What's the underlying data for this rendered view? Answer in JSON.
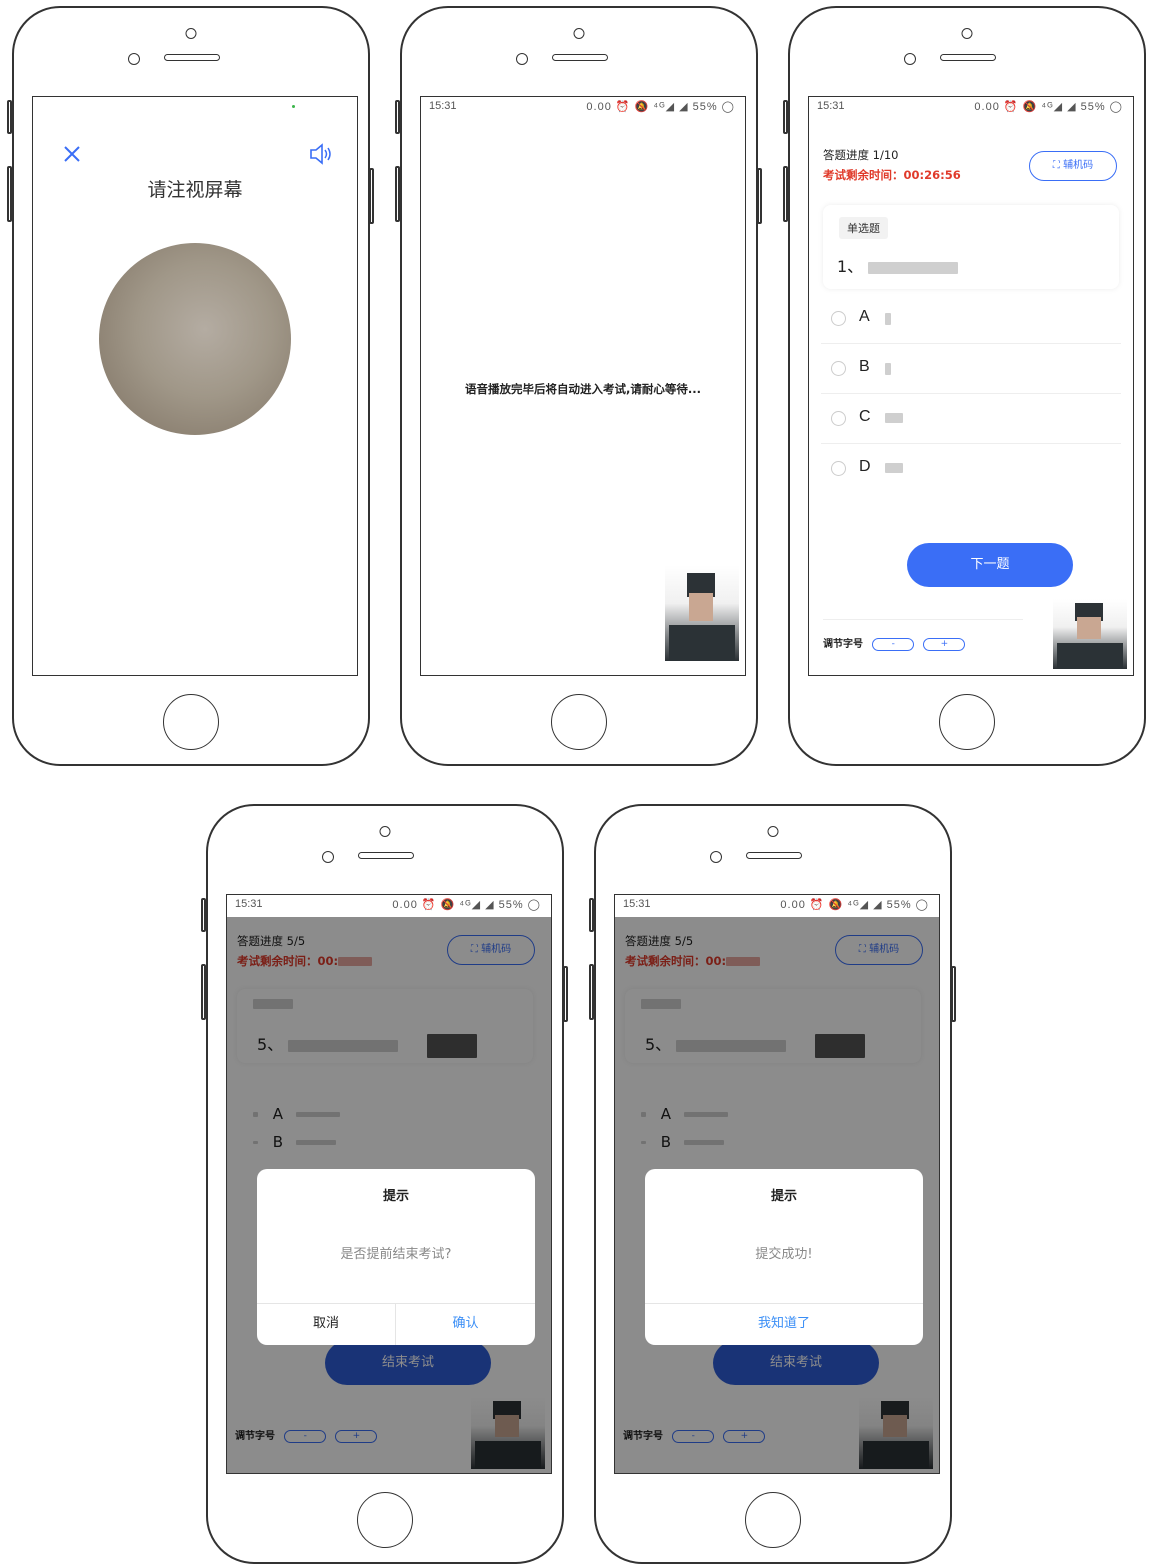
{
  "screens": {
    "s1": {
      "title": "请注视屏幕"
    },
    "s2": {
      "time": "15:31",
      "status_icons": "0.00 ⏰ 🔕 ⁴ᴳ◢ ◢ 55% ◯",
      "message": "语音播放完毕后将自动进入考试,请耐心等待..."
    },
    "s3": {
      "time": "15:31",
      "status_icons": "0.00 ⏰ 🔕 ⁴ᴳ◢ ◢ 55% ◯",
      "progress": "答题进度 1/10",
      "remaining": "考试剩余时间：00:26:56",
      "aux_button": "⛶ 辅机码",
      "question_type": "单选题",
      "question_number": "1、",
      "options": [
        "A",
        "B",
        "C",
        "D"
      ],
      "next_button": "下一题",
      "font_adjust": "调节字号",
      "minus": "-",
      "plus": "+"
    },
    "s4": {
      "time": "15:31",
      "status_icons": "0.00 ⏰ 🔕 ⁴ᴳ◢ ◢ 55% ◯",
      "progress": "答题进度 5/5",
      "remaining": "考试剩余时间：00:",
      "aux_button": "⛶ 辅机码",
      "question_number": "5、",
      "options": [
        "A",
        "B"
      ],
      "end_button": "结束考试",
      "font_adjust": "调节字号",
      "minus": "-",
      "plus": "+",
      "dialog": {
        "title": "提示",
        "message": "是否提前结束考试?",
        "cancel": "取消",
        "confirm": "确认"
      }
    },
    "s5": {
      "time": "15:31",
      "status_icons": "0.00 ⏰ 🔕 ⁴ᴳ◢ ◢ 55% ◯",
      "progress": "答题进度 5/5",
      "remaining": "考试剩余时间：00:",
      "aux_button": "⛶ 辅机码",
      "question_number": "5、",
      "options": [
        "A",
        "B"
      ],
      "end_button": "结束考试",
      "font_adjust": "调节字号",
      "minus": "-",
      "plus": "+",
      "dialog": {
        "title": "提示",
        "message": "提交成功!",
        "ok": "我知道了"
      }
    }
  },
  "colors": {
    "accent": "#3a6ef6",
    "danger": "#e03a2a",
    "overlay": "rgba(0,0,0,0.45)"
  }
}
